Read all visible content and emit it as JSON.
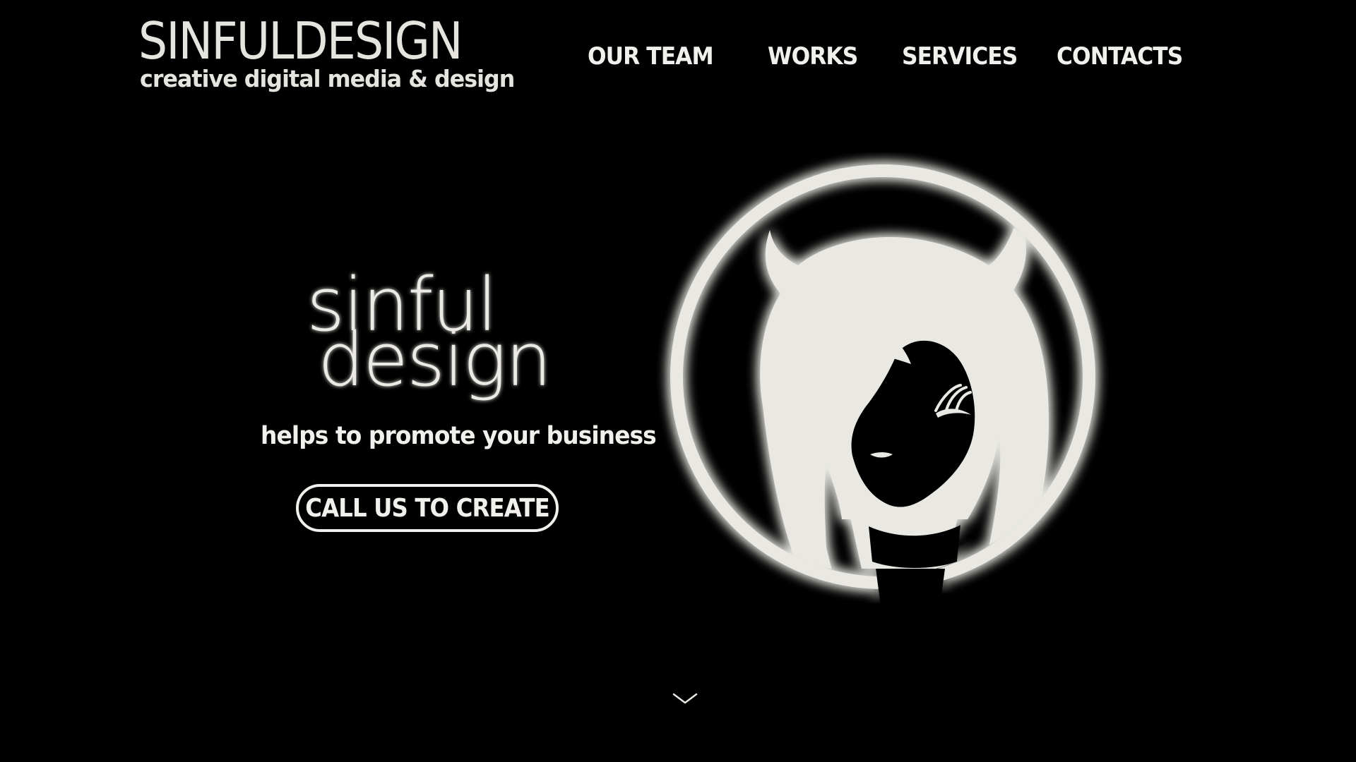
{
  "header": {
    "logo_title": "SINFULDESIGN",
    "logo_tagline": "creative digital media & design",
    "nav": [
      {
        "label": "OUR TEAM"
      },
      {
        "label": "WORKS"
      },
      {
        "label": "SERVICES"
      },
      {
        "label": "CONTACTS"
      }
    ]
  },
  "hero": {
    "wordmark_line1": "sinful",
    "wordmark_line2": "design",
    "tagline": "helps to promote your business",
    "cta_label": "CALL US TO CREATE",
    "emblem_icon": "devil-girl-emblem-icon",
    "scroll_icon": "chevron-down-icon"
  },
  "colors": {
    "background": "#000000",
    "foreground": "#e8e6e1"
  }
}
